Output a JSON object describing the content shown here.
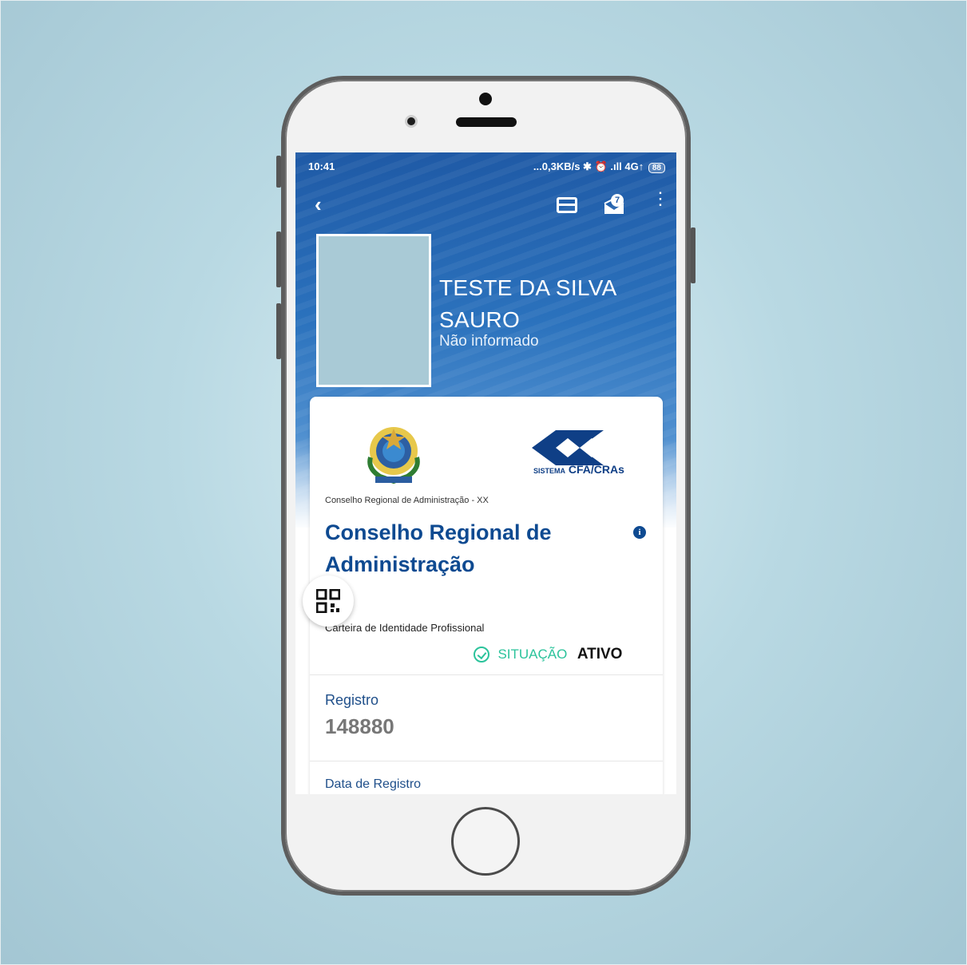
{
  "status_bar": {
    "time": "10:41",
    "indicators": "...0,3KB/s ✱ ⏰ .ıll 4G↑",
    "battery": "88"
  },
  "toolbar": {
    "back_icon": "chevron-left-icon",
    "card_icon": "credit-card-icon",
    "mail_icon": "mail-icon",
    "mail_badge": "7",
    "menu_icon": "more-vertical-icon"
  },
  "profile": {
    "name_line1": "TESTE DA SILVA",
    "name_line2": "SAURO",
    "subtitle": "Não informado"
  },
  "card": {
    "logo_left": "brazil-coat-of-arms",
    "logo_right_small": "SISTEMA",
    "logo_right_big": "CFA/CRAs",
    "council_small": "Conselho Regional de Administração - XX",
    "council_title": "Conselho Regional de Administração",
    "info_icon": "i",
    "carteira": "Carteira de Identidade Profissional",
    "situacao_label": "SITUAÇÃO",
    "situacao_value": "ATIVO",
    "registro_label": "Registro",
    "registro_value": "148880",
    "data_registro_label": "Data de Registro"
  },
  "colors": {
    "primary_blue": "#0e4a91",
    "status_green": "#2bc39b",
    "background": "#b9d9e3"
  }
}
